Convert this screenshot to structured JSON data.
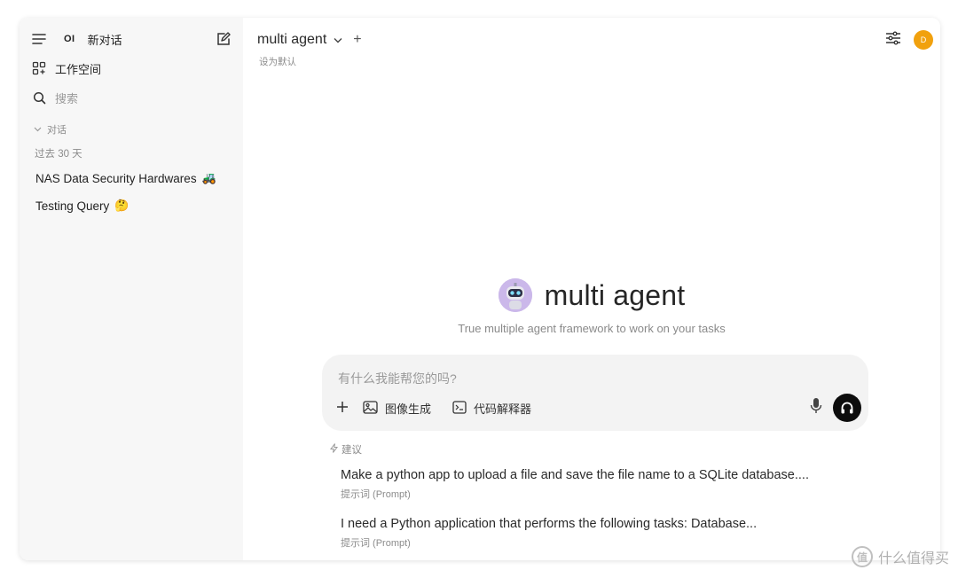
{
  "sidebar": {
    "logo": "OI",
    "new_chat_label": "新对话",
    "workspace_label": "工作空间",
    "search_placeholder": "搜索",
    "section_label": "对话",
    "period_label": "过去 30 天",
    "chats": [
      {
        "title": "NAS Data Security Hardwares",
        "emoji": "🚜"
      },
      {
        "title": "Testing Query",
        "emoji": "🤔"
      }
    ]
  },
  "header": {
    "model_name": "multi agent",
    "set_default": "设为默认",
    "avatar_letter": "D",
    "avatar_color": "#f1a10e"
  },
  "hero": {
    "title": "multi agent",
    "subtitle": "True multiple agent framework to work on your tasks"
  },
  "composer": {
    "placeholder": "有什么我能帮您的吗?",
    "image_gen_label": "图像生成",
    "code_interpreter_label": "代码解释器"
  },
  "suggestions": {
    "header": "建议",
    "items": [
      {
        "title": "Make a python app to upload a file and save the file name to a SQLite database....",
        "subtitle": "提示词 (Prompt)"
      },
      {
        "title": "I need a Python application that performs the following tasks: Database...",
        "subtitle": "提示词 (Prompt)"
      }
    ]
  },
  "watermark": {
    "text": "什么值得买",
    "badge": "值"
  }
}
